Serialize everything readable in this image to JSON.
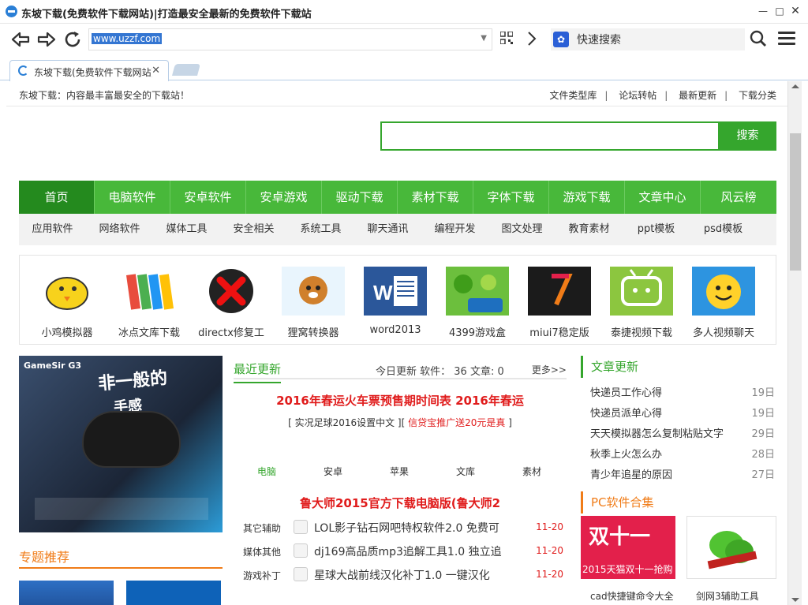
{
  "window": {
    "title": "东坡下载(免费软件下载网站)|打造最安全最新的免费软件下载站"
  },
  "address": {
    "url": "www.uzzf.com",
    "search_engine_text": "快速搜索"
  },
  "tab": {
    "title": "东坡下载(免费软件下载网站)|打造最安全最新的免费软件下载站"
  },
  "page": {
    "slogan": "东坡下载：内容最丰富最安全的下载站！",
    "toplinks": [
      "文件类型库",
      "论坛转帖",
      "最新更新",
      "下载分类"
    ],
    "search_button": "搜索",
    "mainnav": [
      "首页",
      "电脑软件",
      "安卓软件",
      "安卓游戏",
      "驱动下载",
      "素材下载",
      "字体下载",
      "游戏下载",
      "文章中心",
      "风云榜"
    ],
    "subnav": [
      "应用软件",
      "网络软件",
      "媒体工具",
      "安全相关",
      "系统工具",
      "聊天通讯",
      "编程开发",
      "图文处理",
      "教育素材",
      "ppt模板",
      "psd模板"
    ],
    "apps": [
      {
        "name": "小鸡模拟器",
        "icon": "chick-emulator-icon"
      },
      {
        "name": "冰点文库下载",
        "icon": "books-icon"
      },
      {
        "name": "directx修复工",
        "icon": "directx-icon"
      },
      {
        "name": "狸窝转换器",
        "icon": "raccoon-icon"
      },
      {
        "name": "word2013",
        "icon": "word-icon"
      },
      {
        "name": "4399游戏盒",
        "icon": "plants-game-icon"
      },
      {
        "name": "miui7稳定版",
        "icon": "miui-icon"
      },
      {
        "name": "泰捷视频下载",
        "icon": "tv-icon"
      },
      {
        "name": "多人视频聊天",
        "icon": "smiley-chat-icon"
      }
    ],
    "banner": {
      "brand": "GameSir G3",
      "slogan_a": "非一般的",
      "slogan_b": "手感"
    },
    "left_section_title": "专题推荐",
    "recent": {
      "title": "最近更新",
      "stats": "今日更新 软件： 36 文章: 0",
      "more": "更多>>",
      "headline": "2016年春运火车票预售期时间表 2016年春运",
      "sub_left": "[ 实况足球2016设置中文 ][",
      "sub_red": "信贷宝推广送20元是真",
      "sub_right": "]",
      "cats": [
        "电脑",
        "安卓",
        "苹果",
        "文库",
        "素材"
      ],
      "headline2": "鲁大师2015官方下载电脑版(鲁大师2",
      "rows": [
        {
          "cat": "其它辅助",
          "text": "LOL影子钻石网吧特权软件2.0 免费可",
          "date": "11-20"
        },
        {
          "cat": "媒体其他",
          "text": "dj169高品质mp3追解工具1.0 独立追",
          "date": "11-20"
        },
        {
          "cat": "游戏补丁",
          "text": "星球大战前线汉化补丁1.0 一键汉化",
          "date": "11-20"
        }
      ]
    },
    "articles": {
      "title": "文章更新",
      "items": [
        {
          "title": "快递员工作心得",
          "date": "19日"
        },
        {
          "title": "快递员派单心得",
          "date": "19日"
        },
        {
          "title": "天天模拟器怎么复制粘贴文字",
          "date": "29日"
        },
        {
          "title": "秋季上火怎么办",
          "date": "28日"
        },
        {
          "title": "青少年追星的原因",
          "date": "27日"
        }
      ]
    },
    "pc_collection": {
      "title": "PC软件合集",
      "promo_big": "双十一",
      "promo_caption": "2015天猫双十一抢购",
      "bottom_left": "cad快捷键命令大全",
      "bottom_right": "剑网3辅助工具"
    }
  }
}
